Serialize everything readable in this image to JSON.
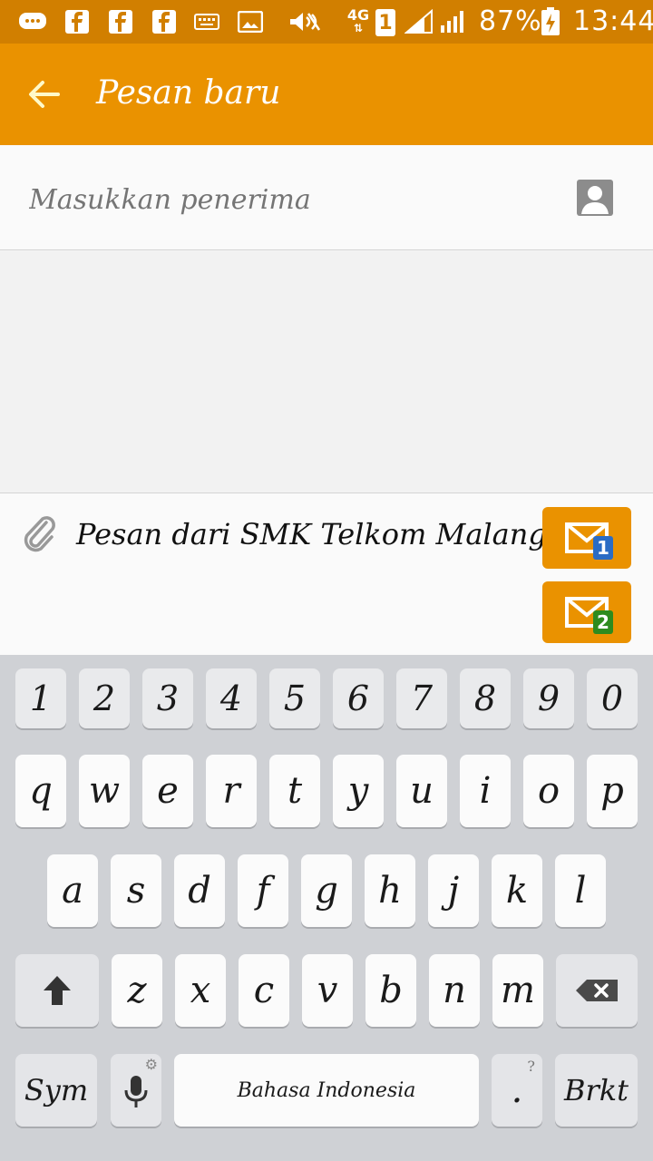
{
  "status_bar": {
    "network": "4G",
    "sim_slot": "1",
    "battery": "87%",
    "time": "13:44",
    "icons": [
      "chat-icon",
      "facebook-icon",
      "facebook-icon",
      "facebook-icon",
      "keyboard-icon",
      "image-icon",
      "mute-icon",
      "network-4g-icon",
      "sim-1-icon",
      "signal-icon",
      "signal-icon",
      "battery-charging-icon"
    ]
  },
  "app_bar": {
    "title": "Pesan baru",
    "back_icon": "arrow-left-icon"
  },
  "recipient": {
    "placeholder": "Masukkan penerima",
    "contact_icon": "contact-icon"
  },
  "composer": {
    "message": "Pesan dari SMK Telkom Malang",
    "attach_icon": "paperclip-icon",
    "send_sim1_badge": "1",
    "send_sim2_badge": "2"
  },
  "keyboard": {
    "numbers": [
      "1",
      "2",
      "3",
      "4",
      "5",
      "6",
      "7",
      "8",
      "9",
      "0"
    ],
    "row1": [
      "q",
      "w",
      "e",
      "r",
      "t",
      "y",
      "u",
      "i",
      "o",
      "p"
    ],
    "row2": [
      "a",
      "s",
      "d",
      "f",
      "g",
      "h",
      "j",
      "k",
      "l"
    ],
    "row3": [
      "z",
      "x",
      "c",
      "v",
      "b",
      "n",
      "m"
    ],
    "sym_label": "Sym",
    "space_label": "Bahasa Indonesia",
    "period_label": ".",
    "period_sub": "?",
    "enter_label": "Brkt"
  },
  "colors": {
    "status_bar": "#d17f00",
    "app_bar": "#ea9200",
    "sim1": "#2b6cc4",
    "sim2": "#2e8b1e"
  }
}
